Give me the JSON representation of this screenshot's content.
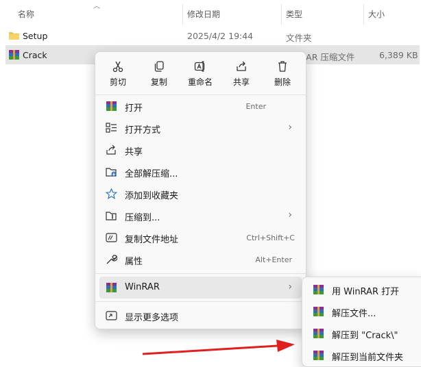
{
  "header": {
    "col_name": "名称",
    "col_modified": "修改日期",
    "col_type": "类型",
    "col_size": "大小"
  },
  "files": [
    {
      "name": "Setup",
      "modified": "2025/4/2 19:44",
      "type": "文件夹",
      "size": "",
      "icon": "folder-icon"
    },
    {
      "name": "Crack",
      "modified": "",
      "type": "RAR 压缩文件",
      "size": "6,389 KB",
      "icon": "winrar-icon"
    }
  ],
  "quick_actions": [
    {
      "label": "剪切",
      "icon": "scissors-icon"
    },
    {
      "label": "复制",
      "icon": "copy-icon"
    },
    {
      "label": "重命名",
      "icon": "rename-icon"
    },
    {
      "label": "共享",
      "icon": "share-icon"
    },
    {
      "label": "删除",
      "icon": "trash-icon"
    }
  ],
  "menu": [
    {
      "label": "打开",
      "shortcut": "Enter",
      "icon": "winrar-icon"
    },
    {
      "label": "打开方式",
      "submenu": true,
      "icon": "open-with-icon"
    },
    {
      "label": "共享",
      "icon": "share-icon"
    },
    {
      "label": "全部解压缩...",
      "icon": "extract-all-icon"
    },
    {
      "label": "添加到收藏夹",
      "icon": "star-icon"
    },
    {
      "label": "压缩到...",
      "submenu": true,
      "icon": "compress-icon"
    },
    {
      "label": "复制文件地址",
      "shortcut": "Ctrl+Shift+C",
      "icon": "copy-path-icon"
    },
    {
      "label": "属性",
      "shortcut": "Alt+Enter",
      "icon": "wrench-icon"
    },
    {
      "label": "WinRAR",
      "submenu": true,
      "icon": "winrar-icon"
    },
    {
      "label": "显示更多选项",
      "icon": "more-options-icon"
    }
  ],
  "winrar_submenu": [
    {
      "label": "用 WinRAR 打开",
      "icon": "winrar-icon"
    },
    {
      "label": "解压文件...",
      "icon": "winrar-icon"
    },
    {
      "label": "解压到 \"Crack\\\"",
      "icon": "winrar-icon"
    },
    {
      "label": "解压到当前文件夹",
      "icon": "winrar-icon"
    }
  ],
  "colors": {
    "selection": "#e5e5e5",
    "menu_bg": "#f9f9f9",
    "arrow": "#e02020",
    "folder": "#f2c14e"
  }
}
